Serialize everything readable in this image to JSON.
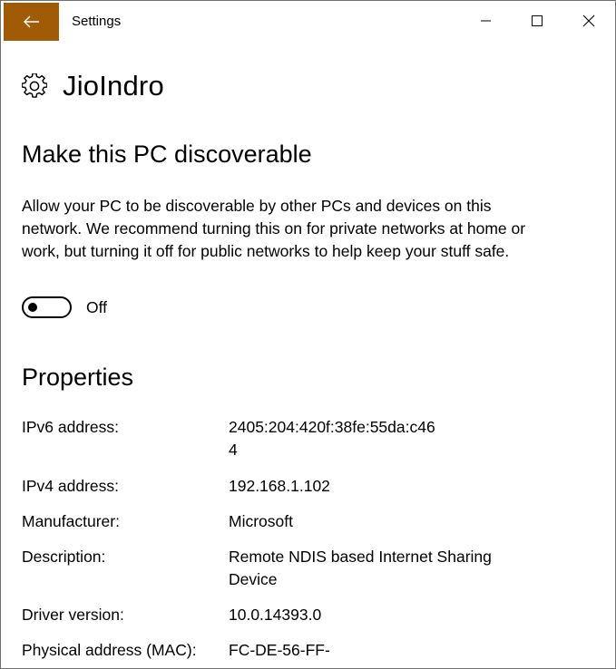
{
  "window": {
    "title": "Settings",
    "accent_color": "#a15a05"
  },
  "icons": {
    "back": "arrow-left-icon",
    "minimize": "minimize-icon",
    "maximize": "maximize-icon",
    "close": "close-icon",
    "header": "gear-icon"
  },
  "page": {
    "title": "JioIndro"
  },
  "discoverable": {
    "heading": "Make this PC discoverable",
    "description": "Allow your PC to be discoverable by other PCs and devices on this network. We recommend turning this on for private networks at home or work, but turning it off for public networks to help keep your stuff safe.",
    "toggle_state": "Off"
  },
  "properties": {
    "heading": "Properties",
    "items": [
      {
        "name": "IPv6 address:",
        "value": "2405:204:420f:38fe:55da:c46",
        "value_line2": "4"
      },
      {
        "name": "IPv4 address:",
        "value": "192.168.1.102"
      },
      {
        "name": "Manufacturer:",
        "value": "Microsoft"
      },
      {
        "name": "Description:",
        "value": "Remote NDIS based Internet Sharing Device"
      },
      {
        "name": "Driver version:",
        "value": "10.0.14393.0"
      },
      {
        "name": "Physical address (MAC):",
        "value": "FC-DE-56-FF-"
      }
    ]
  }
}
